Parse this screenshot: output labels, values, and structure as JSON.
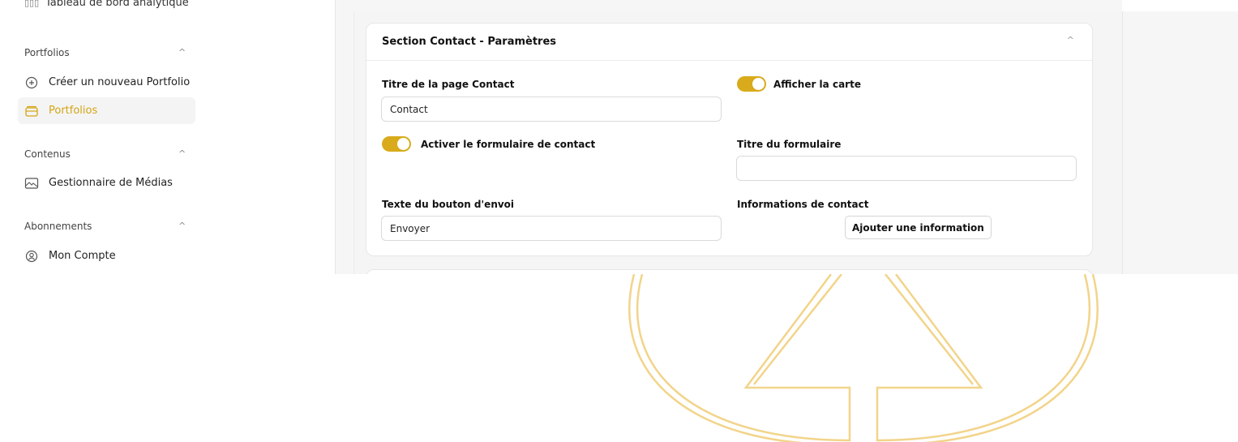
{
  "sidebar": {
    "cut_item": "Tableau de bord analytique",
    "sections": [
      {
        "title": "Portfolios",
        "items": [
          {
            "label": "Créer un nouveau Portfolio",
            "icon": "plus-circle-icon"
          },
          {
            "label": "Portfolios",
            "icon": "folder-icon",
            "active": true
          }
        ]
      },
      {
        "title": "Contenus",
        "items": [
          {
            "label": "Gestionnaire de Médias",
            "icon": "image-icon"
          }
        ]
      },
      {
        "title": "Abonnements",
        "items": [
          {
            "label": "Mon Compte",
            "icon": "user-circle-icon"
          }
        ]
      }
    ]
  },
  "card": {
    "title": "Section Contact - Paramètres",
    "page_title_label": "Titre de la page Contact",
    "page_title_value": "Contact",
    "show_map_label": "Afficher la carte",
    "show_map_on": true,
    "enable_form_label": "Activer le formulaire de contact",
    "enable_form_on": true,
    "form_title_label": "Titre du formulaire",
    "form_title_value": "",
    "submit_text_label": "Texte du bouton d'envoi",
    "submit_text_value": "Envoyer",
    "contact_info_label": "Informations de contact",
    "add_info_button": "Ajouter une information"
  },
  "colors": {
    "accent": "#d9ab1c",
    "active_text": "#d4a514",
    "logo": "#f2d48a"
  }
}
